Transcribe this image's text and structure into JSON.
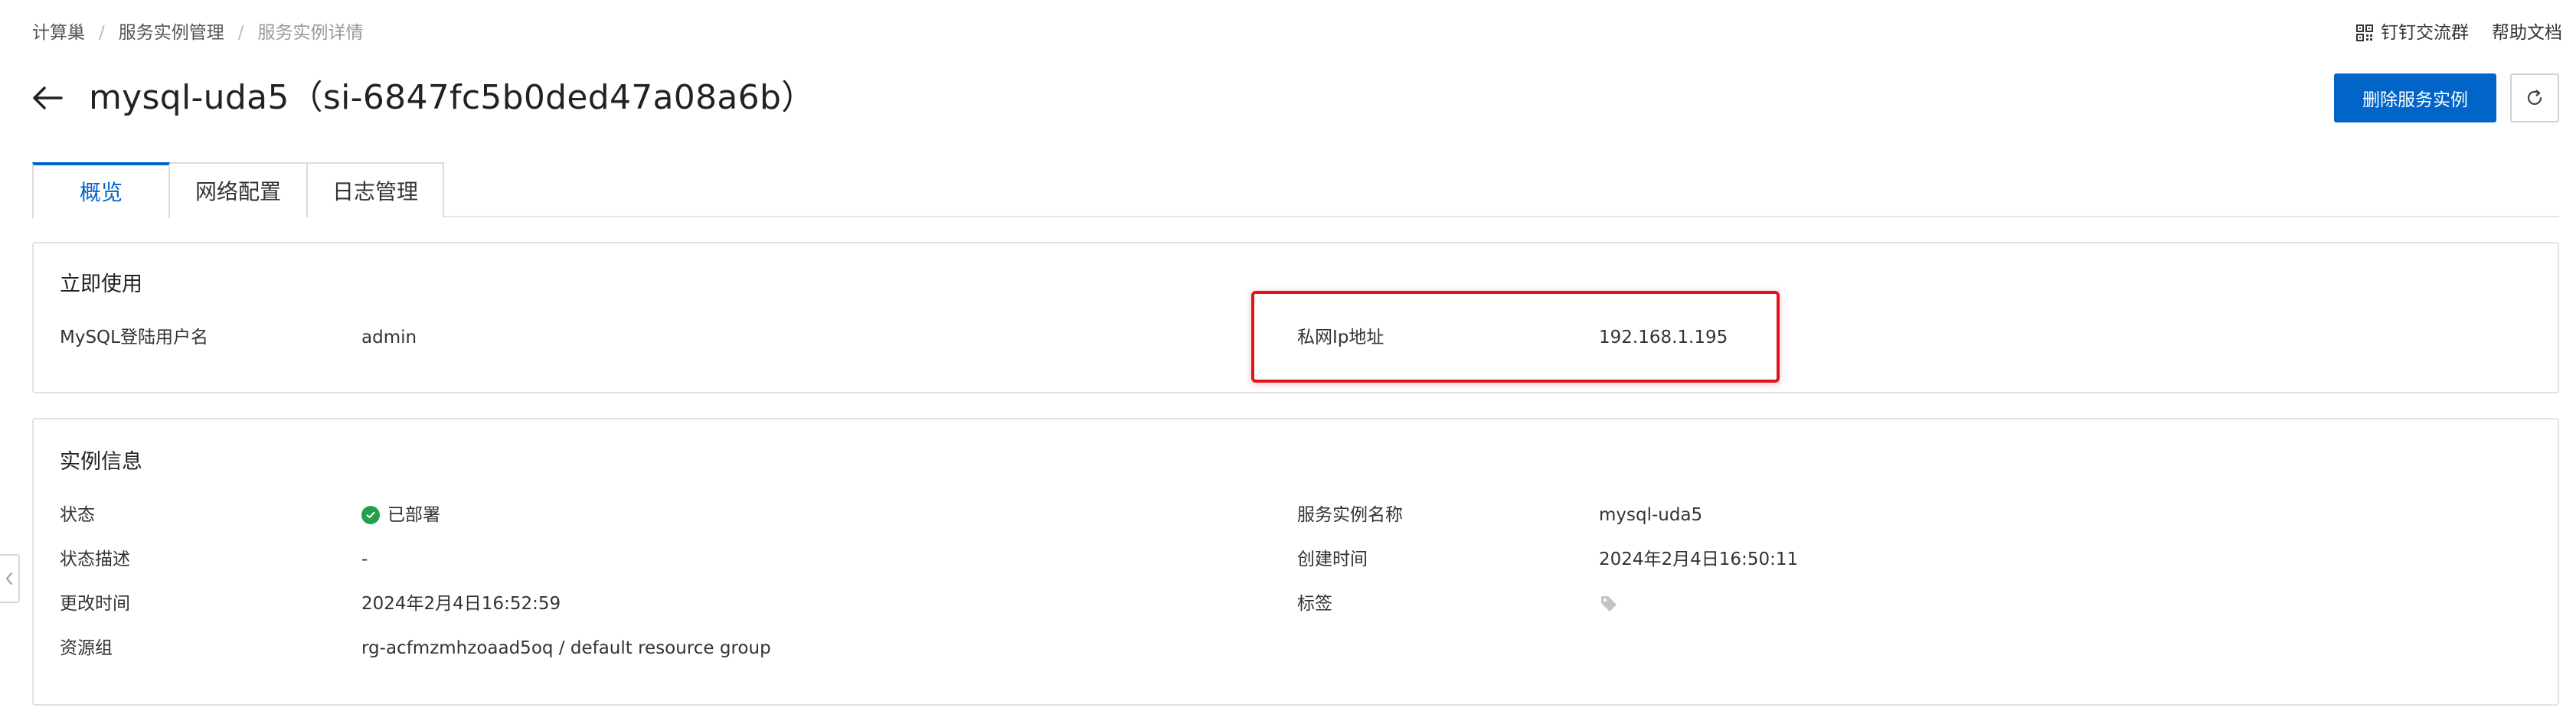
{
  "breadcrumb": {
    "items": [
      "计算巢",
      "服务实例管理",
      "服务实例详情"
    ],
    "separator": "/"
  },
  "top_links": {
    "dingtalk": "钉钉交流群",
    "help": "帮助文档"
  },
  "header": {
    "title": "mysql-uda5（si-6847fc5b0ded47a08a6b）",
    "delete_button": "删除服务实例"
  },
  "tabs": [
    {
      "label": "概览",
      "active": true
    },
    {
      "label": "网络配置",
      "active": false
    },
    {
      "label": "日志管理",
      "active": false
    }
  ],
  "quick_use": {
    "title": "立即使用",
    "username_label": "MySQL登陆用户名",
    "username_value": "admin",
    "ip_label": "私网Ip地址",
    "ip_value": "192.168.1.195"
  },
  "instance_info": {
    "title": "实例信息",
    "status_label": "状态",
    "status_value": "已部署",
    "status_desc_label": "状态描述",
    "status_desc_value": "-",
    "modified_label": "更改时间",
    "modified_value": "2024年2月4日16:52:59",
    "resource_group_label": "资源组",
    "resource_group_value": "rg-acfmzmhzoaad5oq / default resource group",
    "name_label": "服务实例名称",
    "name_value": "mysql-uda5",
    "created_label": "创建时间",
    "created_value": "2024年2月4日16:50:11",
    "tags_label": "标签"
  },
  "colors": {
    "primary": "#0064c8",
    "success": "#23a14a",
    "highlight": "#e0141e"
  },
  "icons": {
    "back": "arrow-left-icon",
    "refresh": "refresh-icon",
    "qrcode": "qrcode-icon",
    "status": "check-circle-icon",
    "tag": "tag-icon",
    "collapse": "chevron-left-icon"
  }
}
